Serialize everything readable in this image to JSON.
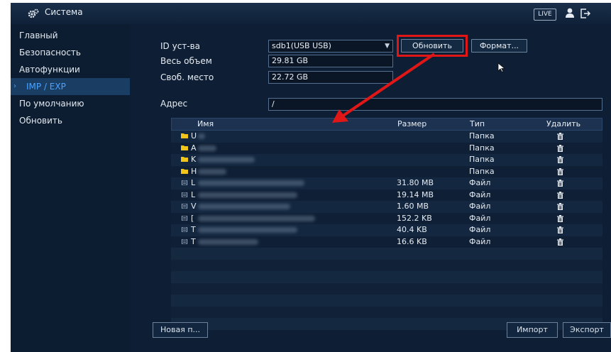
{
  "topbar": {
    "title": "Система",
    "live_label": "LIVE"
  },
  "sidebar": {
    "items": [
      {
        "label": "Главный"
      },
      {
        "label": "Безопасность"
      },
      {
        "label": "Автофункции"
      },
      {
        "label": "IMP / EXP"
      },
      {
        "label": "По умолчанию"
      },
      {
        "label": "Обновить"
      }
    ]
  },
  "form": {
    "device_label": "ID уст-ва",
    "device_value": "sdb1(USB USB)",
    "refresh_button": "Обновить",
    "format_button": "Формат...",
    "total_label": "Весь объем",
    "total_value": "29.81 GB",
    "free_label": "Своб. место",
    "free_value": "22.72 GB",
    "address_label": "Адрес",
    "address_value": "/"
  },
  "table": {
    "headers": [
      "Имя",
      "Размер",
      "Тип",
      "Удалить"
    ],
    "rows": [
      {
        "icon": "folder-icon",
        "name_initial": "U",
        "size": "",
        "type": "Папка"
      },
      {
        "icon": "folder-icon",
        "name_initial": "A",
        "size": "",
        "type": "Папка"
      },
      {
        "icon": "folder-icon",
        "name_initial": "K",
        "size": "",
        "type": "Папка"
      },
      {
        "icon": "folder-icon",
        "name_initial": "H",
        "size": "",
        "type": "Папка"
      },
      {
        "icon": "file-icon",
        "name_initial": "L",
        "size": "31.80 MB",
        "type": "Файл"
      },
      {
        "icon": "file-icon",
        "name_initial": "L",
        "size": "19.14 MB",
        "type": "Файл"
      },
      {
        "icon": "file-icon",
        "name_initial": "V",
        "size": "1.60 MB",
        "type": "Файл"
      },
      {
        "icon": "file-icon",
        "name_initial": "[",
        "size": "152.2 KB",
        "type": "Файл"
      },
      {
        "icon": "file-icon",
        "name_initial": "T",
        "size": "40.4 KB",
        "type": "Файл"
      },
      {
        "icon": "file-icon",
        "name_initial": "T",
        "size": "16.6 KB",
        "type": "Файл"
      }
    ],
    "empty_rows": 7
  },
  "footer": {
    "new_folder_button": "Новая п...",
    "import_button": "Импорт",
    "export_button": "Экспорт"
  },
  "colors": {
    "accent_blue": "#4aa3ff",
    "highlight_red": "#e11717",
    "panel_bg": "#0e1f35"
  }
}
